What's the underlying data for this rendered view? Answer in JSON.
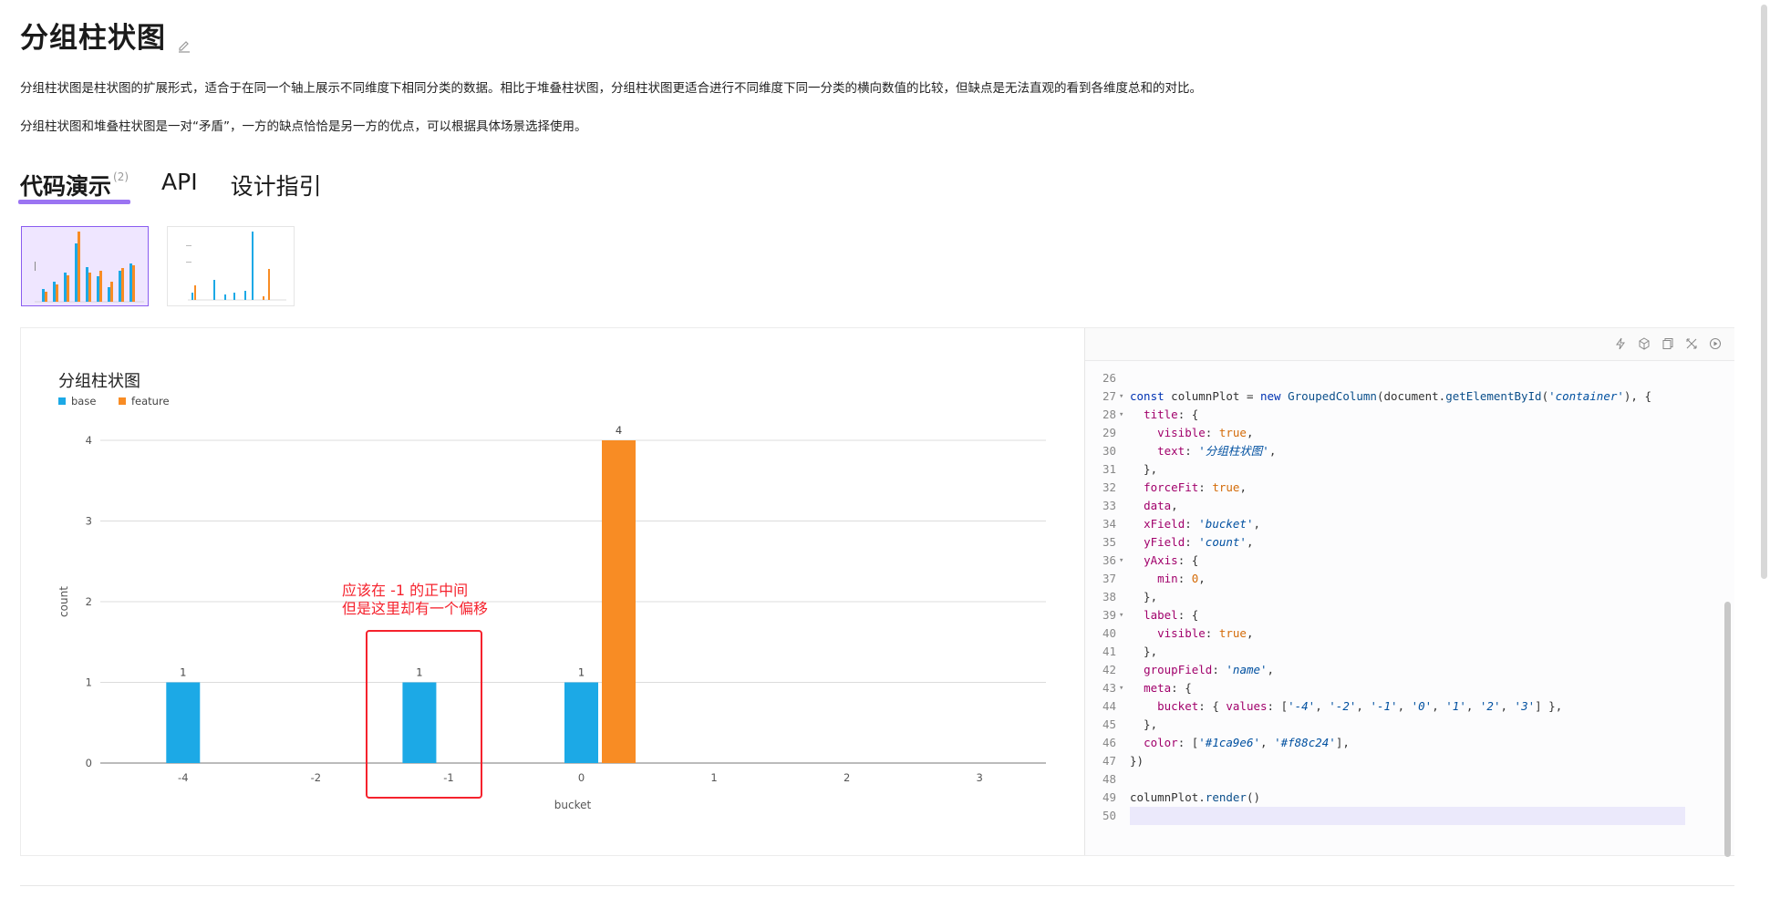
{
  "page": {
    "title": "分组柱状图",
    "desc1": "分组柱状图是柱状图的扩展形式，适合于在同一个轴上展示不同维度下相同分类的数据。相比于堆叠柱状图，分组柱状图更适合进行不同维度下同一分类的横向数值的比较，但缺点是无法直观的看到各维度总和的对比。",
    "desc2": "分组柱状图和堆叠柱状图是一对“矛盾”，一方的缺点恰恰是另一方的优点，可以根据具体场景选择使用。"
  },
  "tabs": [
    {
      "label": "代码演示",
      "count": "(2)"
    },
    {
      "label": "API"
    },
    {
      "label": "设计指引"
    }
  ],
  "annotation": {
    "line1": "应该在 -1 的正中间",
    "line2": "但是这里却有一个偏移",
    "color": "#f5222d"
  },
  "chart_data": {
    "type": "bar",
    "title": "分组柱状图",
    "xlabel": "bucket",
    "ylabel": "count",
    "categories": [
      "-4",
      "-2",
      "-1",
      "0",
      "1",
      "2",
      "3"
    ],
    "series": [
      {
        "name": "base",
        "color": "#1ca9e6",
        "values": [
          1,
          null,
          1,
          1,
          null,
          null,
          null
        ]
      },
      {
        "name": "feature",
        "color": "#f88c24",
        "values": [
          null,
          null,
          null,
          4,
          null,
          null,
          null
        ]
      }
    ],
    "ylim": [
      0,
      4
    ],
    "yticks": [
      0,
      1,
      2,
      3,
      4
    ],
    "legend": "top-left",
    "grid": true
  },
  "code": [
    {
      "n": "26",
      "fold": false,
      "html": ""
    },
    {
      "n": "27",
      "fold": true,
      "html": "<span class='kw'>const</span> columnPlot = <span class='kw'>new</span> <span class='fn'>GroupedColumn</span>(document.<span class='fn'>getElementById</span>(<span class='str'>'container'</span>), {"
    },
    {
      "n": "28",
      "fold": true,
      "html": "  <span class='prop'>title</span>: {"
    },
    {
      "n": "29",
      "fold": false,
      "html": "    <span class='prop'>visible</span>: <span class='bool'>true</span>,"
    },
    {
      "n": "30",
      "fold": false,
      "html": "    <span class='prop'>text</span>: <span class='str'>'分组柱状图'</span>,"
    },
    {
      "n": "31",
      "fold": false,
      "html": "  },"
    },
    {
      "n": "32",
      "fold": false,
      "html": "  <span class='prop'>forceFit</span>: <span class='bool'>true</span>,"
    },
    {
      "n": "33",
      "fold": false,
      "html": "  <span class='prop'>data</span>,"
    },
    {
      "n": "34",
      "fold": false,
      "html": "  <span class='prop'>xField</span>: <span class='str'>'bucket'</span>,"
    },
    {
      "n": "35",
      "fold": false,
      "html": "  <span class='prop'>yField</span>: <span class='str'>'count'</span>,"
    },
    {
      "n": "36",
      "fold": true,
      "html": "  <span class='prop'>yAxis</span>: {"
    },
    {
      "n": "37",
      "fold": false,
      "html": "    <span class='prop'>min</span>: <span class='num'>0</span>,"
    },
    {
      "n": "38",
      "fold": false,
      "html": "  },"
    },
    {
      "n": "39",
      "fold": true,
      "html": "  <span class='prop'>label</span>: {"
    },
    {
      "n": "40",
      "fold": false,
      "html": "    <span class='prop'>visible</span>: <span class='bool'>true</span>,"
    },
    {
      "n": "41",
      "fold": false,
      "html": "  },"
    },
    {
      "n": "42",
      "fold": false,
      "html": "  <span class='prop'>groupField</span>: <span class='str'>'name'</span>,"
    },
    {
      "n": "43",
      "fold": true,
      "html": "  <span class='prop'>meta</span>: {"
    },
    {
      "n": "44",
      "fold": false,
      "html": "    <span class='prop'>bucket</span>: { <span class='prop'>values</span>: [<span class='str'>'-4'</span>, <span class='str'>'-2'</span>, <span class='str'>'-1'</span>, <span class='str'>'0'</span>, <span class='str'>'1'</span>, <span class='str'>'2'</span>, <span class='str'>'3'</span>] },"
    },
    {
      "n": "45",
      "fold": false,
      "html": "  },"
    },
    {
      "n": "46",
      "fold": false,
      "html": "  <span class='prop'>color</span>: [<span class='str'>'#1ca9e6'</span>, <span class='str'>'#f88c24'</span>],"
    },
    {
      "n": "47",
      "fold": false,
      "html": "})"
    },
    {
      "n": "48",
      "fold": false,
      "html": ""
    },
    {
      "n": "49",
      "fold": false,
      "html": "columnPlot.<span class='fn'>render</span>()"
    },
    {
      "n": "50",
      "fold": false,
      "html": "",
      "current": true
    }
  ]
}
